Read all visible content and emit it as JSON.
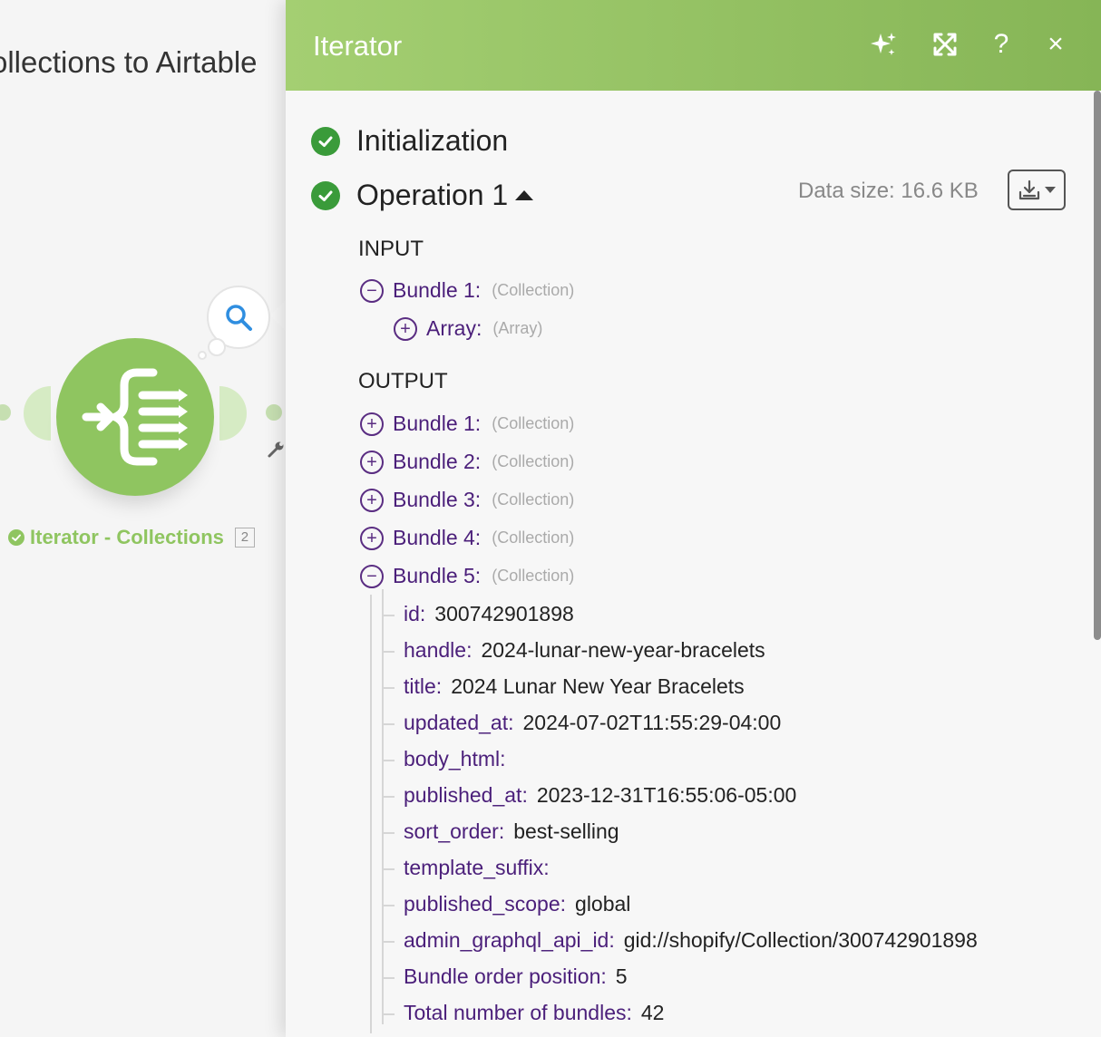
{
  "scenario": {
    "title": "ollections to Airtable"
  },
  "module": {
    "label": "Iterator - Collections",
    "count": "2",
    "brand_color": "#8fc560"
  },
  "panel": {
    "title": "Iterator",
    "header_buttons": {
      "ai": "sparkle-icon",
      "expand": "expand-icon",
      "help": "?",
      "close": "×"
    },
    "initialization": "Initialization",
    "operation": "Operation 1",
    "data_size": "Data size: 16.6 KB",
    "input": {
      "label": "INPUT",
      "bundle": {
        "key": "Bundle 1:",
        "type": "(Collection)"
      },
      "array": {
        "key": "Array:",
        "type": "(Array)"
      }
    },
    "output": {
      "label": "OUTPUT",
      "bundles": [
        {
          "key": "Bundle 1:",
          "type": "(Collection)"
        },
        {
          "key": "Bundle 2:",
          "type": "(Collection)"
        },
        {
          "key": "Bundle 3:",
          "type": "(Collection)"
        },
        {
          "key": "Bundle 4:",
          "type": "(Collection)"
        },
        {
          "key": "Bundle 5:",
          "type": "(Collection)"
        }
      ],
      "fields": [
        {
          "key": "id:",
          "value": "300742901898"
        },
        {
          "key": "handle:",
          "value": "2024-lunar-new-year-bracelets"
        },
        {
          "key": "title:",
          "value": "2024 Lunar New Year Bracelets"
        },
        {
          "key": "updated_at:",
          "value": "2024-07-02T11:55:29-04:00"
        },
        {
          "key": "body_html:",
          "value": ""
        },
        {
          "key": "published_at:",
          "value": "2023-12-31T16:55:06-05:00"
        },
        {
          "key": "sort_order:",
          "value": "best-selling"
        },
        {
          "key": "template_suffix:",
          "value": ""
        },
        {
          "key": "published_scope:",
          "value": "global"
        },
        {
          "key": "admin_graphql_api_id:",
          "value": "gid://shopify/Collection/300742901898"
        },
        {
          "key": "Bundle order position:",
          "value": "5"
        },
        {
          "key": "Total number of bundles:",
          "value": "42"
        }
      ]
    }
  }
}
